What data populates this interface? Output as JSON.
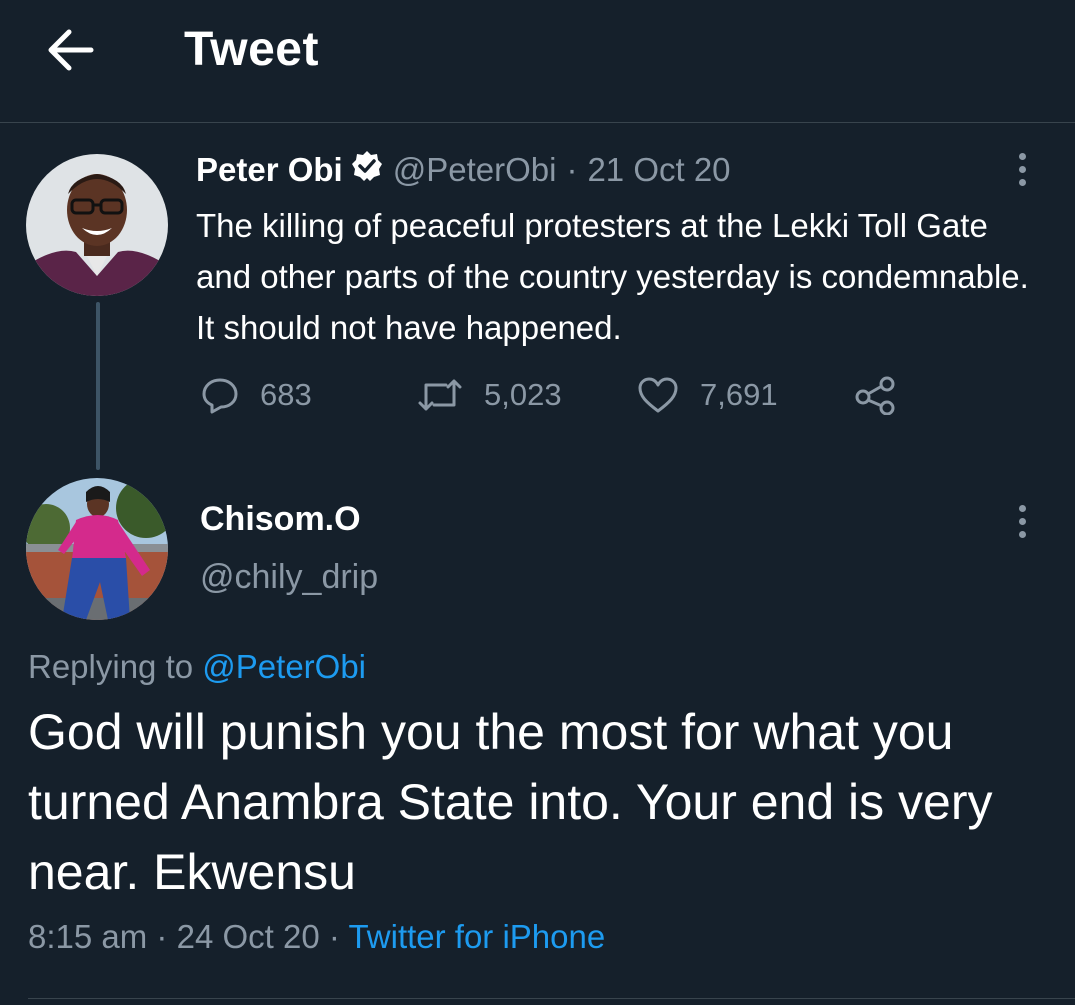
{
  "header": {
    "title": "Tweet",
    "back_icon": "arrow-left-icon"
  },
  "parent_tweet": {
    "author_name": "Peter Obi",
    "verified": true,
    "handle": "@PeterObi",
    "separator": "·",
    "date": "21 Oct 20",
    "text": "The killing of peaceful protesters at the Lekki Toll Gate and other parts of the country yesterday is condemnable. It should not have happened.",
    "actions": {
      "replies": "683",
      "retweets": "5,023",
      "likes": "7,691"
    }
  },
  "reply_tweet": {
    "author_name": "Chisom.O",
    "handle": "@chily_drip",
    "replying_to_label": "Replying to",
    "replying_to_handle": "@PeterObi",
    "text": "God will punish you the most for what you turned Anambra State into. Your end is very near. Ekwensu",
    "time": "8:15 am",
    "sep1": "·",
    "date": "24 Oct 20",
    "sep2": "·",
    "source": "Twitter for iPhone"
  },
  "colors": {
    "background": "#15202b",
    "text": "#ffffff",
    "muted": "#8b98a5",
    "accent": "#1d9bf0",
    "divider": "#38444d"
  }
}
